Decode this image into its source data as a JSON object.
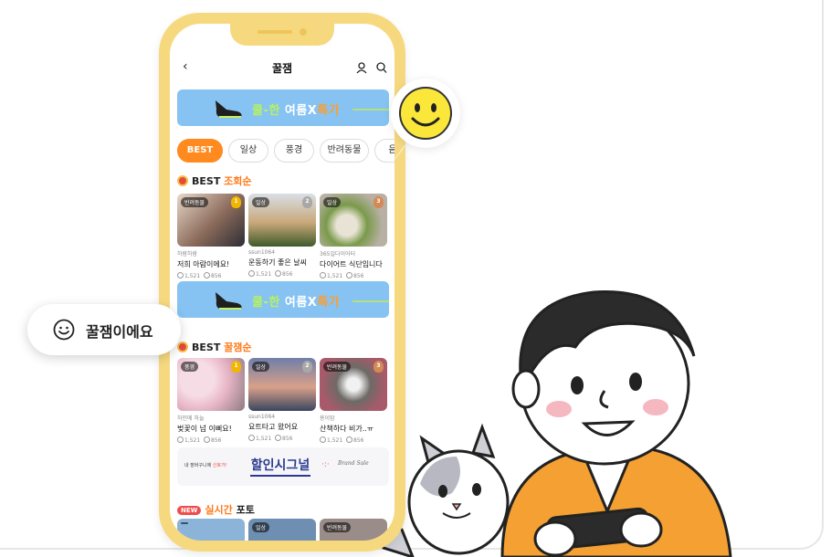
{
  "header": {
    "back_label": "‹",
    "title": "꿀잼"
  },
  "banner": {
    "green": "쿨-한",
    "white": " 여름X",
    "orange": "특가"
  },
  "categories": [
    "BEST",
    "일상",
    "풍경",
    "반려동물",
    "음"
  ],
  "section_best_views": {
    "label": "BEST ",
    "accent": "조회순"
  },
  "best_views_cards": [
    {
      "tag": "반려동물",
      "rank": "1",
      "author": "하람하람",
      "title": "저희 아람이에요!",
      "likes": "1,521",
      "comments": "856"
    },
    {
      "tag": "일상",
      "rank": "2",
      "author": "ssun1064",
      "title": "운동하기 좋은 날씨",
      "likes": "1,521",
      "comments": "856"
    },
    {
      "tag": "일상",
      "rank": "3",
      "author": "365일다이어터",
      "title": "다이어트 식단입니다",
      "likes": "1,521",
      "comments": "856"
    }
  ],
  "section_best_fun": {
    "label": "BEST ",
    "accent": "꿀잼순"
  },
  "best_fun_cards": [
    {
      "tag": "풍경",
      "rank": "1",
      "author": "하민에 하늘",
      "title": "벚꽃이 넘 이뻐요!",
      "likes": "1,521",
      "comments": "856"
    },
    {
      "tag": "일상",
      "rank": "2",
      "author": "ssun1064",
      "title": "요트타고 왔어요",
      "likes": "1,521",
      "comments": "856"
    },
    {
      "tag": "반려동물",
      "rank": "3",
      "author": "용이맘",
      "title": "산책하다 비가..ㅠ",
      "likes": "1,521",
      "comments": "856"
    }
  ],
  "ad": {
    "small_prefix": "내 장바구니에 ",
    "small_accent": "신호가!",
    "big": "할인시그널",
    "dots": "·:·",
    "brand": "Brand Sale"
  },
  "section_realtime": {
    "new_badge": "NEW",
    "accent": "실시간",
    "label": " 포토"
  },
  "bottom_tags": [
    "",
    "일상",
    "반려동물"
  ],
  "bubble": {
    "label": "꿀잼이에요"
  },
  "icons": {
    "user": "user-icon",
    "search": "search-icon",
    "smile": "smiley-face-icon"
  },
  "colors": {
    "accent": "#ff7a1a",
    "phone_frame": "#f6d97f",
    "banner": "#86c3f2"
  }
}
